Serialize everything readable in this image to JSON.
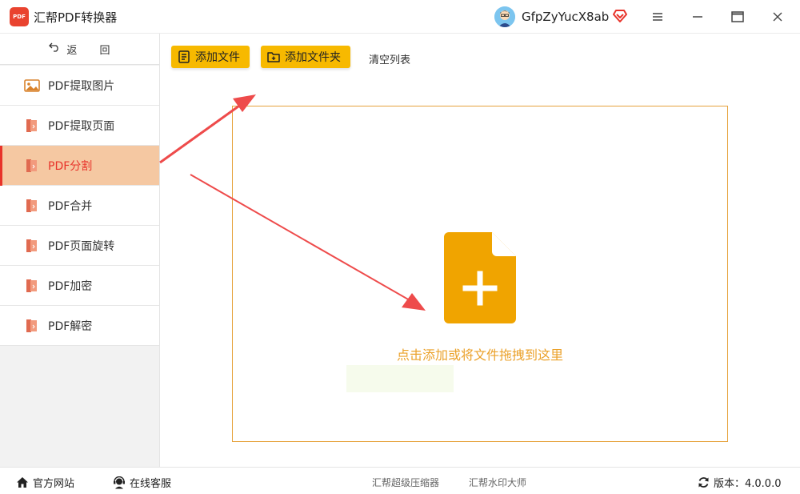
{
  "app": {
    "title": "汇帮PDF转换器",
    "logo_text": "PDF",
    "username": "GfpZyYucX8ab"
  },
  "sidebar": {
    "back_label": "返 回",
    "items": [
      {
        "label": "PDF提取图片",
        "icon": "image-icon",
        "active": false
      },
      {
        "label": "PDF提取页面",
        "icon": "pdf-icon",
        "active": false
      },
      {
        "label": "PDF分割",
        "icon": "pdf-icon",
        "active": true
      },
      {
        "label": "PDF合并",
        "icon": "pdf-icon",
        "active": false
      },
      {
        "label": "PDF页面旋转",
        "icon": "pdf-icon",
        "active": false
      },
      {
        "label": "PDF加密",
        "icon": "pdf-icon",
        "active": false
      },
      {
        "label": "PDF解密",
        "icon": "pdf-icon",
        "active": false
      }
    ]
  },
  "toolbar": {
    "add_file_label": "添加文件",
    "add_folder_label": "添加文件夹",
    "clear_label": "清空列表"
  },
  "dropzone": {
    "hint": "点击添加或将文件拖拽到这里"
  },
  "footer": {
    "site_label": "官方网站",
    "service_label": "在线客服",
    "link_compress": "汇帮超级压缩器",
    "link_watermark": "汇帮水印大师",
    "version_label": "版本：4.0.0.0"
  },
  "colors": {
    "accent_yellow": "#f7b900",
    "active_bg": "#f5c8a2",
    "active_text": "#e8332a",
    "drop_icon": "#f0a400",
    "annotation_arrow": "#ee4b4b"
  }
}
